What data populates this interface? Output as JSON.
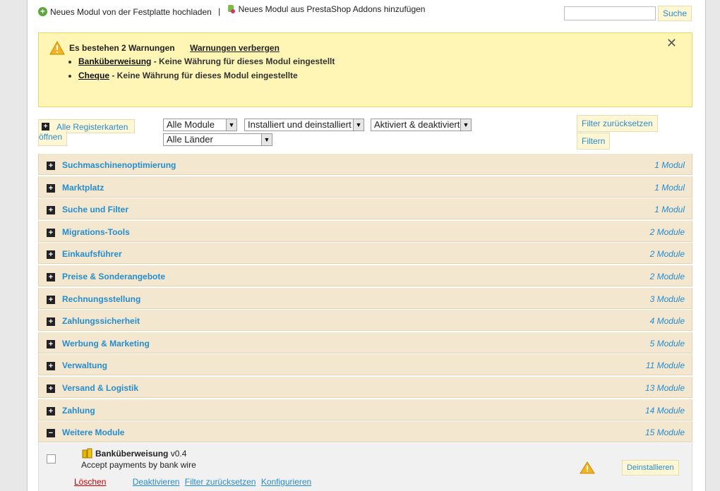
{
  "top": {
    "upload_label": "Neues Modul von der Festplatte hochladen",
    "separator": "|",
    "addons_label": "Neues Modul aus PrestaShop Addons hinzufügen",
    "search_button": "Suche",
    "search_value": ""
  },
  "warnings": {
    "title": "Es bestehen 2 Warnungen",
    "hide_link": "Warnungen verbergen",
    "close": "✕",
    "items": [
      {
        "name": "Banküberweisung",
        "text": " - Keine Währung für dieses Modul eingestellt"
      },
      {
        "name": "Cheque",
        "text": " - Keine Währung für dieses Modul eingestellte"
      }
    ]
  },
  "filters": {
    "open_all_line1": "Alle Registerkarten",
    "open_all_line2": "öffnen",
    "modules_select": "Alle Module",
    "installed_select": "Installiert und deinstalliert",
    "active_select": "Aktiviert & deaktiviert",
    "country_select": "Alle Länder",
    "reset_button": "Filter zurücksetzen",
    "filter_button": "Filtern"
  },
  "categories": [
    {
      "name": "Suchmaschinenoptimierung",
      "count": "1 Modul",
      "expanded": false
    },
    {
      "name": "Marktplatz",
      "count": "1 Modul",
      "expanded": false
    },
    {
      "name": "Suche und Filter",
      "count": "1 Modul",
      "expanded": false
    },
    {
      "name": "Migrations-Tools",
      "count": "2 Module",
      "expanded": false
    },
    {
      "name": "Einkaufsführer",
      "count": "2 Module",
      "expanded": false
    },
    {
      "name": "Preise & Sonderangebote",
      "count": "2 Module",
      "expanded": false
    },
    {
      "name": "Rechnungsstellung",
      "count": "3 Module",
      "expanded": false
    },
    {
      "name": "Zahlungssicherheit",
      "count": "4 Module",
      "expanded": false
    },
    {
      "name": "Werbung & Marketing",
      "count": "5 Module",
      "expanded": false
    },
    {
      "name": "Verwaltung",
      "count": "11 Module",
      "expanded": false
    },
    {
      "name": "Versand & Logistik",
      "count": "13 Module",
      "expanded": false
    },
    {
      "name": "Zahlung",
      "count": "14 Module",
      "expanded": false
    },
    {
      "name": "Weitere Module",
      "count": "15 Module",
      "expanded": true
    }
  ],
  "module": {
    "name": "Banküberweisung",
    "version": " v0.4",
    "description": "Accept payments by bank wire",
    "uninstall_button": "Deinstallieren",
    "delete_link": "Löschen",
    "deactivate_link": "Deaktivieren",
    "reset_link": "Filter zurücksetzen",
    "configure_link": "Konfigurieren"
  },
  "colors": {
    "accent_blue": "#268ccd",
    "warning_bg": "#fff6b5",
    "category_bg": "#f3e7cf",
    "delete_red": "#cc0000"
  }
}
